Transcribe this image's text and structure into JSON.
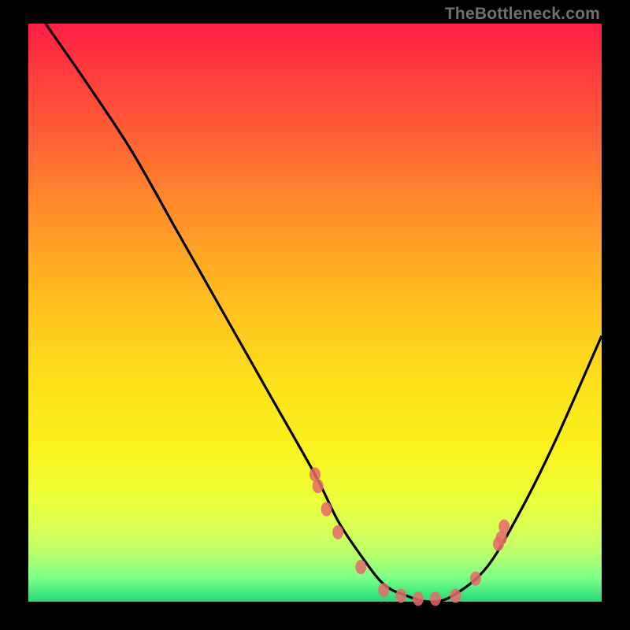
{
  "attribution": "TheBottleneck.com",
  "chart_data": {
    "type": "line",
    "title": "",
    "xlabel": "",
    "ylabel": "",
    "ylim": [
      0,
      100
    ],
    "xlim": [
      0,
      100
    ],
    "series": [
      {
        "name": "bottleneck-curve",
        "x": [
          3,
          10,
          18,
          26,
          34,
          42,
          50,
          54,
          58,
          62,
          66,
          70,
          74,
          80,
          86,
          92,
          100
        ],
        "values": [
          100,
          90,
          78,
          64,
          50,
          36,
          22,
          14,
          8,
          3,
          1,
          0,
          1,
          6,
          16,
          28,
          46
        ]
      }
    ],
    "markers": {
      "name": "highlight-points",
      "color": "#e56a6a",
      "x": [
        50,
        50.5,
        52,
        54,
        58,
        62,
        65,
        68,
        71,
        74.5,
        78,
        82,
        82.5,
        83
      ],
      "values": [
        22,
        20,
        16,
        12,
        6,
        2,
        1,
        0.5,
        0.5,
        1,
        4,
        10,
        11,
        13
      ]
    }
  }
}
